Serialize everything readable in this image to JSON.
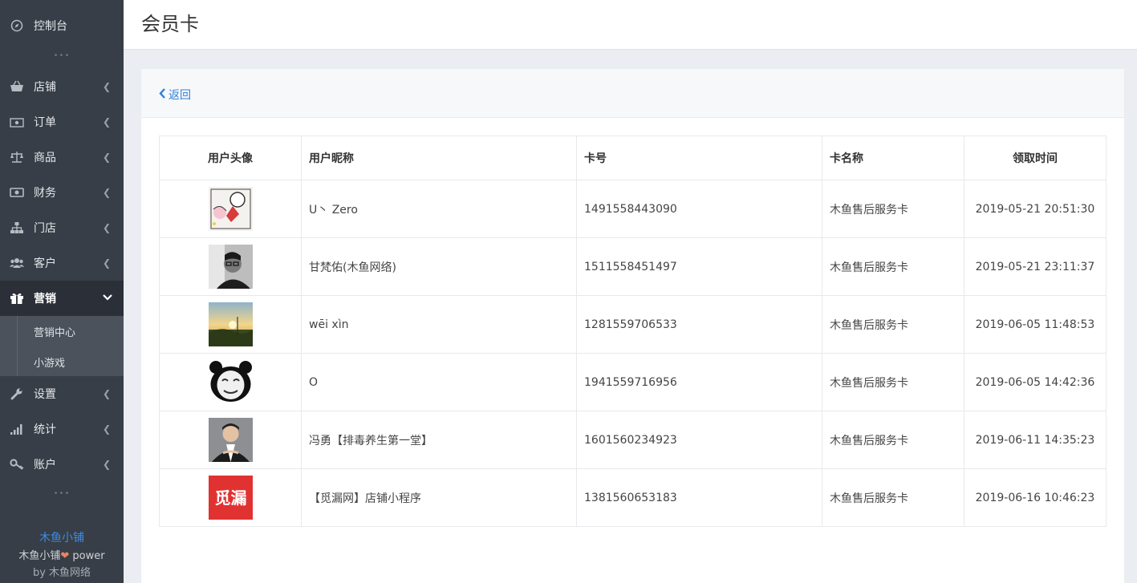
{
  "sidebar": {
    "dashboard": "控制台",
    "items": [
      {
        "label": "店铺",
        "icon": "basket-icon"
      },
      {
        "label": "订单",
        "icon": "money-icon"
      },
      {
        "label": "商品",
        "icon": "scale-icon"
      },
      {
        "label": "财务",
        "icon": "cash-icon"
      },
      {
        "label": "门店",
        "icon": "sitemap-icon"
      },
      {
        "label": "客户",
        "icon": "users-icon"
      },
      {
        "label": "营销",
        "icon": "gift-icon"
      },
      {
        "label": "设置",
        "icon": "wrench-icon"
      },
      {
        "label": "统计",
        "icon": "signal-icon"
      },
      {
        "label": "账户",
        "icon": "key-icon"
      }
    ],
    "submenu": [
      "营销中心",
      "小游戏"
    ],
    "footer": {
      "brand": "木鱼小铺",
      "line2_a": "木鱼小铺",
      "line2_b": " power",
      "line3": "by 木鱼网络"
    }
  },
  "header": {
    "title": "会员卡"
  },
  "card": {
    "back": "返回"
  },
  "table": {
    "headers": [
      "用户头像",
      "用户昵称",
      "卡号",
      "卡名称",
      "领取时间"
    ],
    "rows": [
      {
        "nickname": "U丶 Zero",
        "card_no": "1491558443090",
        "card_name": "木鱼售后服务卡",
        "time": "2019-05-21 20:51:30",
        "avatar": "cartoon-avatar"
      },
      {
        "nickname": "甘梵佑(木鱼网络)",
        "card_no": "1511558451497",
        "card_name": "木鱼售后服务卡",
        "time": "2019-05-21 23:11:37",
        "avatar": "photo-avatar-glasses"
      },
      {
        "nickname": "wēi xìn",
        "card_no": "1281559706533",
        "card_name": "木鱼售后服务卡",
        "time": "2019-06-05 11:48:53",
        "avatar": "sunset-avatar"
      },
      {
        "nickname": "O",
        "card_no": "1941559716956",
        "card_name": "木鱼售后服务卡",
        "time": "2019-06-05 14:42:36",
        "avatar": "panda-meme-avatar"
      },
      {
        "nickname": "冯勇【排毒养生第一堂】",
        "card_no": "1601560234923",
        "card_name": "木鱼售后服务卡",
        "time": "2019-06-11 14:35:23",
        "avatar": "portrait-avatar"
      },
      {
        "nickname": "【觅漏网】店铺小程序",
        "card_no": "1381560653183",
        "card_name": "木鱼售后服务卡",
        "time": "2019-06-16 10:46:23",
        "avatar": "milou-logo-avatar",
        "avatar_text": "觅漏"
      }
    ]
  }
}
